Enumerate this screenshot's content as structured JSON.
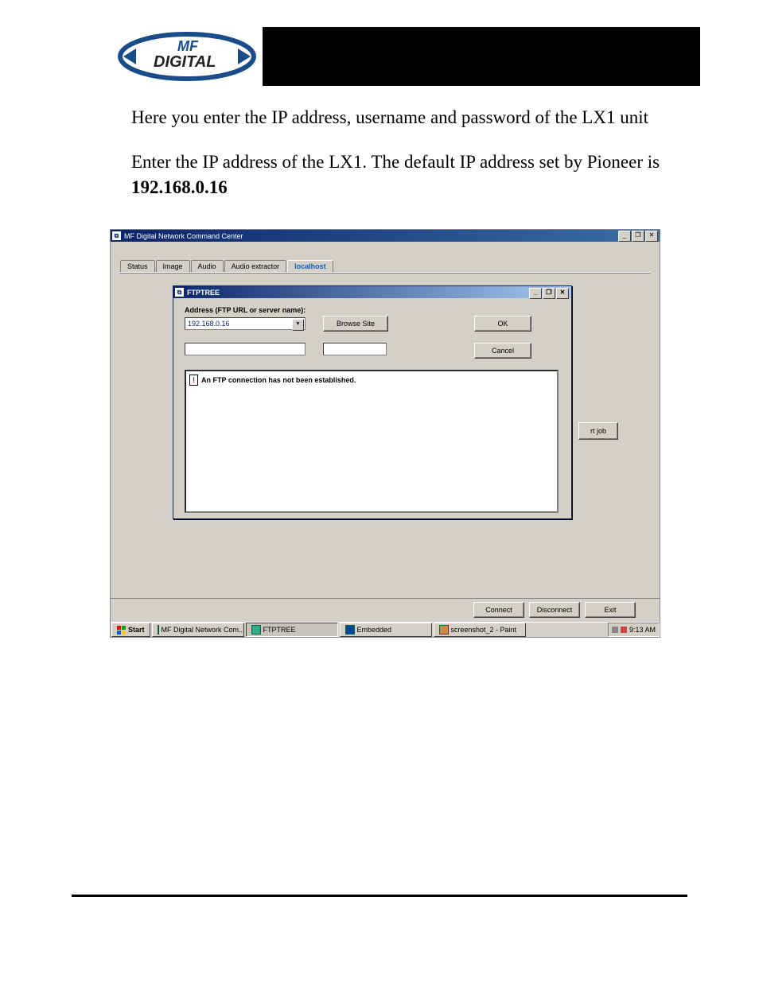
{
  "logo": {
    "text_top": "MF",
    "text_bottom": "DIGITAL"
  },
  "content": {
    "para1": "Here you enter the IP address, username and password of the LX1 unit",
    "para2_pre": "Enter the IP address of the LX1.  The default IP address set by Pioneer is ",
    "para2_bold": "192.168.0.16"
  },
  "app": {
    "outer_title": "MF Digital Network Command Center",
    "tabs": [
      "Status",
      "Image",
      "Audio",
      "Audio extractor",
      "localhost"
    ],
    "active_tab_index": 4,
    "partial_button": "rt job",
    "buttons": {
      "connect": "Connect",
      "disconnect": "Disconnect",
      "exit": "Exit"
    }
  },
  "dialog": {
    "title": "FTPTREE",
    "address_label": "Address (FTP URL or server name):",
    "address_value": "192.168.0.16",
    "browse_label": "Browse Site",
    "ok_label": "OK",
    "cancel_label": "Cancel",
    "user_value": "",
    "pass_value": "",
    "tree_message": "An FTP connection has not been established."
  },
  "taskbar": {
    "start": "Start",
    "items": [
      "MF Digital Network Com...",
      "FTPTREE",
      "Embedded",
      "screenshot_2 - Paint"
    ],
    "active_index": 1,
    "clock": "9:13 AM"
  },
  "win_controls": {
    "min": "_",
    "max": "❐",
    "restore": "❐",
    "close": "✕"
  }
}
